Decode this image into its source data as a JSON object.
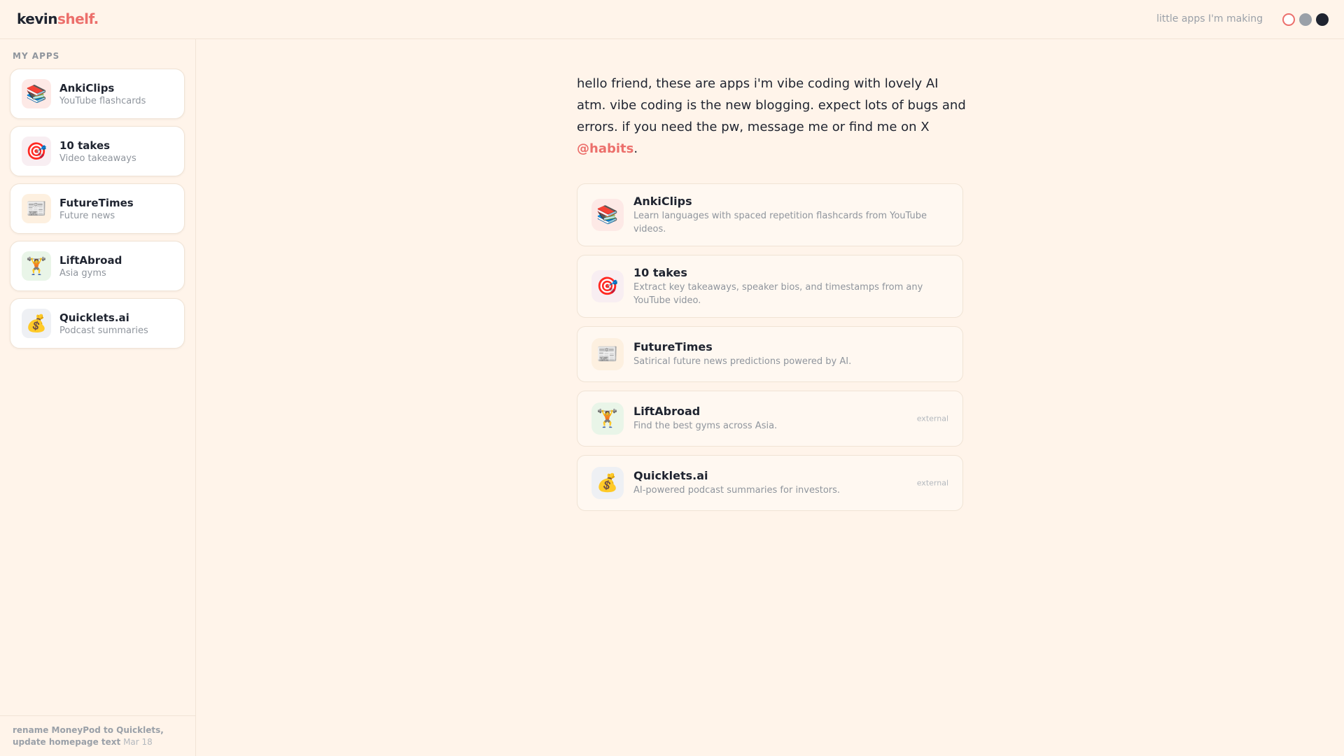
{
  "header": {
    "logo_main": "kevin",
    "logo_accent": "shelf.",
    "tagline": "little apps I'm making"
  },
  "colors": {
    "background": "#fff4ea",
    "accent": "#ec6f6b",
    "text": "#1f2430",
    "muted": "#8f959d"
  },
  "sidebar": {
    "heading": "MY APPS",
    "items": [
      {
        "name": "AnkiClips",
        "subtitle": "YouTube flashcards",
        "icon": "books-icon",
        "glyph": "📚",
        "icon_bg": "#fde9e6"
      },
      {
        "name": "10 takes",
        "subtitle": "Video takeaways",
        "icon": "target-icon",
        "glyph": "🎯",
        "icon_bg": "#f8eef2"
      },
      {
        "name": "FutureTimes",
        "subtitle": "Future news",
        "icon": "newspaper-icon",
        "glyph": "📰",
        "icon_bg": "#fdf0e0"
      },
      {
        "name": "LiftAbroad",
        "subtitle": "Asia gyms",
        "icon": "weightlifter-icon",
        "glyph": "🏋",
        "icon_bg": "#e9f5e8"
      },
      {
        "name": "Quicklets.ai",
        "subtitle": "Podcast summaries",
        "icon": "money-bag-icon",
        "glyph": "💰",
        "icon_bg": "#eef0f4"
      }
    ],
    "footer": {
      "commit": "rename MoneyPod to Quicklets, update homepage text",
      "date": "Mar 18"
    }
  },
  "intro": {
    "text": "hello friend, these are apps i'm vibe coding with lovely AI atm. vibe coding is the new blogging. expect lots of bugs and errors. if you need the pw, message me or find me on X ",
    "handle": "@habits",
    "end": "."
  },
  "cards": [
    {
      "name": "AnkiClips",
      "description": "Learn languages with spaced repetition flashcards from YouTube videos.",
      "tag": ""
    },
    {
      "name": "10 takes",
      "description": "Extract key takeaways, speaker bios, and timestamps from any YouTube video.",
      "tag": ""
    },
    {
      "name": "FutureTimes",
      "description": "Satirical future news predictions powered by AI.",
      "tag": ""
    },
    {
      "name": "LiftAbroad",
      "description": "Find the best gyms across Asia.",
      "tag": "external"
    },
    {
      "name": "Quicklets.ai",
      "description": "AI-powered podcast summaries for investors.",
      "tag": "external"
    }
  ]
}
